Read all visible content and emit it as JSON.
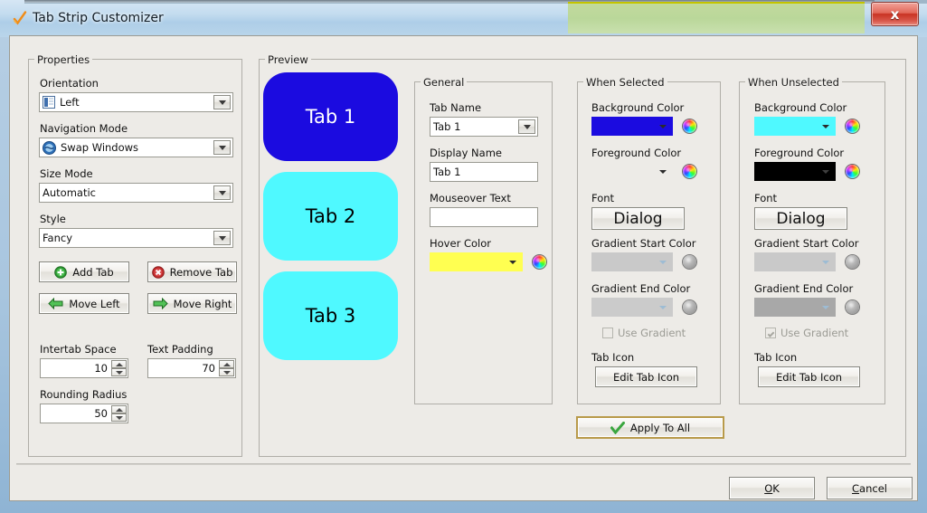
{
  "window": {
    "title": "Tab Strip Customizer",
    "icon": "checkmark-icon",
    "close_label": "x"
  },
  "properties": {
    "title": "Properties",
    "orientation_label": "Orientation",
    "orientation_value": "Left",
    "navigation_label": "Navigation Mode",
    "navigation_value": "Swap Windows",
    "size_mode_label": "Size Mode",
    "size_mode_value": "Automatic",
    "style_label": "Style",
    "style_value": "Fancy",
    "add_tab": "Add Tab",
    "remove_tab": "Remove Tab",
    "move_left": "Move Left",
    "move_right": "Move Right",
    "intertab_label": "Intertab Space",
    "intertab_value": "10",
    "text_padding_label": "Text Padding",
    "text_padding_value": "70",
    "rounding_label": "Rounding Radius",
    "rounding_value": "50"
  },
  "preview": {
    "title": "Preview",
    "tabs": [
      {
        "label": "Tab 1",
        "background": "#1b0be0",
        "foreground": "#ffffff",
        "selected": true
      },
      {
        "label": "Tab 2",
        "background": "#4ff9ff",
        "foreground": "#000000",
        "selected": false
      },
      {
        "label": "Tab 3",
        "background": "#4ff9ff",
        "foreground": "#000000",
        "selected": false
      }
    ]
  },
  "general": {
    "title": "General",
    "tab_name_label": "Tab Name",
    "tab_name_value": "Tab 1",
    "display_name_label": "Display Name",
    "display_name_value": "Tab 1",
    "mouseover_label": "Mouseover Text",
    "mouseover_value": "",
    "hover_color_label": "Hover Color",
    "hover_color_value": "#ffff51"
  },
  "when_selected": {
    "title": "When Selected",
    "background_label": "Background Color",
    "background_value": "#1b0be0",
    "foreground_label": "Foreground Color",
    "foreground_value": "#edebe7",
    "font_label": "Font",
    "font_value": "Dialog",
    "gradient_start_label": "Gradient Start Color",
    "gradient_start_value": "#c9c9c9",
    "gradient_end_label": "Gradient End Color",
    "gradient_end_value": "#cbcbcb",
    "use_gradient_label": "Use Gradient",
    "use_gradient_checked": false,
    "tab_icon_label": "Tab Icon",
    "edit_tab_icon": "Edit Tab Icon"
  },
  "when_unselected": {
    "title": "When Unselected",
    "background_label": "Background Color",
    "background_value": "#4ff9ff",
    "foreground_label": "Foreground Color",
    "foreground_value": "#000000",
    "font_label": "Font",
    "font_value": "Dialog",
    "gradient_start_label": "Gradient Start Color",
    "gradient_start_value": "#c9c9c9",
    "gradient_end_label": "Gradient End Color",
    "gradient_end_value": "#a8a8a8",
    "use_gradient_label": "Use Gradient",
    "use_gradient_checked": true,
    "tab_icon_label": "Tab Icon",
    "edit_tab_icon": "Edit Tab Icon"
  },
  "actions": {
    "apply_to_all": "Apply To All",
    "ok_mnemonic": "O",
    "ok_rest": "K",
    "cancel_mnemonic": "C",
    "cancel_rest": "ancel"
  }
}
